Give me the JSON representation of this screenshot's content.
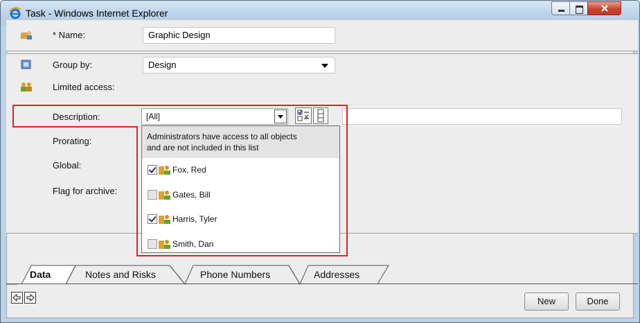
{
  "window": {
    "title": "Task - Windows Internet Explorer"
  },
  "form": {
    "name": {
      "label": "* Name:",
      "value": "Graphic Design"
    },
    "group_by": {
      "label": "Group by:",
      "value": "Design"
    },
    "limited_access": {
      "label": "Limited access:",
      "value": "[All]"
    },
    "description": {
      "label": "Description:",
      "value": ""
    },
    "prorating": {
      "label": "Prorating:"
    },
    "global": {
      "label": "Global:"
    },
    "flag_for_archive": {
      "label": "Flag for archive:"
    }
  },
  "access_list": {
    "note_line1": "Administrators have access to all objects",
    "note_line2": "and are not included in this list",
    "items": [
      {
        "name": "Fox, Red",
        "checked": true
      },
      {
        "name": "Gates, Bill",
        "checked": false
      },
      {
        "name": "Harris, Tyler",
        "checked": true
      },
      {
        "name": "Smith, Dan",
        "checked": false
      }
    ]
  },
  "tabs": [
    {
      "label": "Data",
      "active": true
    },
    {
      "label": "Notes and Risks",
      "active": false
    },
    {
      "label": "Phone Numbers",
      "active": false
    },
    {
      "label": "Addresses",
      "active": false
    }
  ],
  "buttons": {
    "new_label": "New",
    "done_label": "Done"
  },
  "icons": {
    "title": "ie-icon",
    "name_row": "task-icon",
    "group_row": "group-icon",
    "access_row": "users-icon",
    "select_all": "select-all-icon",
    "columns": "columns-icon",
    "nav_prev": "arrow-left-icon",
    "nav_next": "arrow-right-icon"
  },
  "colors": {
    "highlight": "#dd2222",
    "title_bar": "#bcd2e8"
  }
}
